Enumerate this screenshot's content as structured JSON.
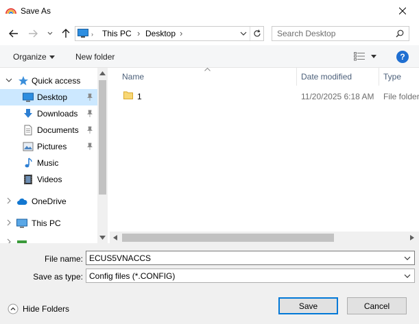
{
  "window": {
    "title": "Save As"
  },
  "address": {
    "crumbs": [
      "This PC",
      "Desktop"
    ]
  },
  "search": {
    "placeholder": "Search Desktop"
  },
  "toolbar": {
    "organize": "Organize",
    "new_folder": "New folder",
    "help": "?"
  },
  "nav": {
    "quick_access": "Quick access",
    "items": [
      {
        "label": "Desktop"
      },
      {
        "label": "Downloads"
      },
      {
        "label": "Documents"
      },
      {
        "label": "Pictures"
      },
      {
        "label": "Music"
      },
      {
        "label": "Videos"
      }
    ],
    "onedrive": "OneDrive",
    "this_pc": "This PC"
  },
  "columns": {
    "name": "Name",
    "date": "Date modified",
    "type": "Type"
  },
  "files": [
    {
      "name": "1",
      "date": "11/20/2025 6:18 AM",
      "type": "File folder"
    }
  ],
  "form": {
    "filename_label": "File name:",
    "filename_value": "ECUS5VNACCS",
    "type_label": "Save as type:",
    "type_value": "Config files (*.CONFIG)"
  },
  "footer": {
    "hide_folders": "Hide Folders",
    "save": "Save",
    "cancel": "Cancel"
  },
  "colors": {
    "accent": "#0078d7",
    "selected": "#cce8ff",
    "folder": "#f8d775"
  }
}
